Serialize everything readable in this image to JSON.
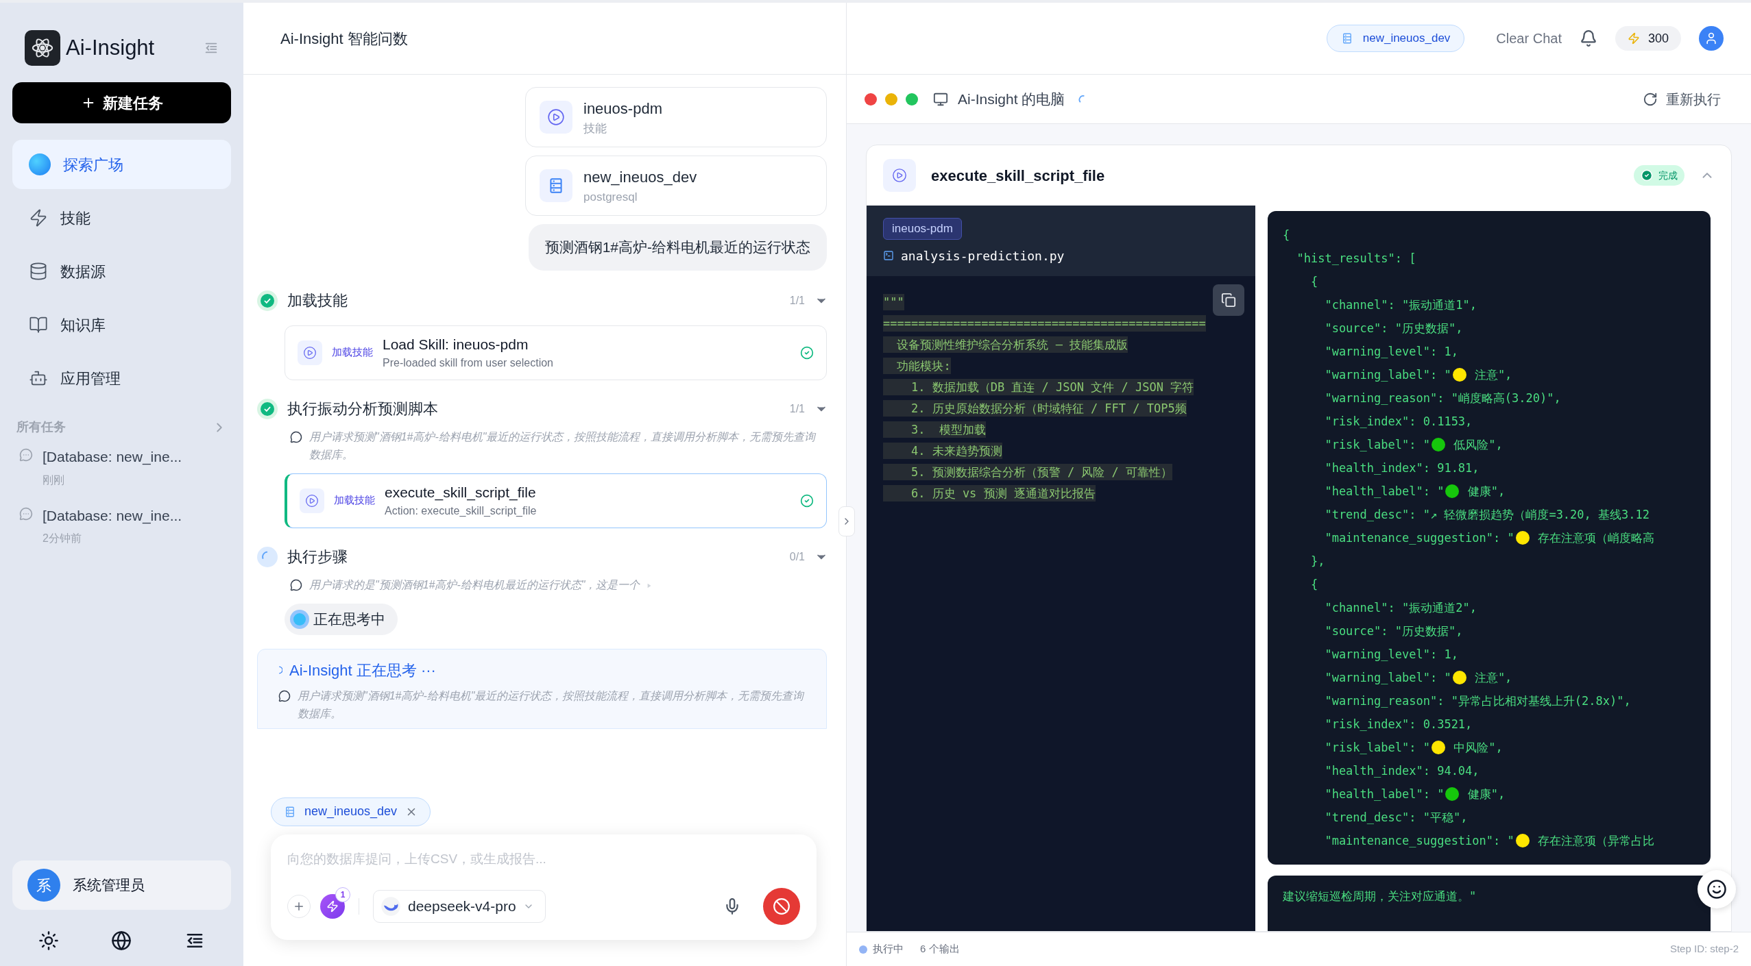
{
  "sidebar": {
    "logo": "Ai-Insight",
    "new_task": "新建任务",
    "nav": [
      {
        "label": "探索广场",
        "selected": true
      },
      {
        "label": "技能",
        "selected": false
      },
      {
        "label": "数据源",
        "selected": false
      },
      {
        "label": "知识库",
        "selected": false
      },
      {
        "label": "应用管理",
        "selected": false
      }
    ],
    "tasks_heading": "所有任务",
    "tasks": [
      {
        "title": "[Database: new_ine...",
        "time": "刚刚"
      },
      {
        "title": "[Database: new_ine...",
        "time": "2分钟前"
      }
    ],
    "user": {
      "avatar": "系",
      "name": "系统管理员"
    }
  },
  "header": {
    "title": "Ai-Insight 智能问数",
    "datasource": "new_ineuos_dev",
    "clear": "Clear Chat",
    "credits": "300"
  },
  "chat": {
    "attachments": [
      {
        "kind": "skill",
        "name": "ineuos-pdm",
        "sub": "技能"
      },
      {
        "kind": "database",
        "name": "new_ineuos_dev",
        "sub": "postgresql"
      }
    ],
    "user_message": "预测酒钢1#高炉-给料电机最近的运行状态",
    "steps": [
      {
        "title": "加载技能",
        "done": true,
        "count": "1/1",
        "items": [
          {
            "tag": "加载技能",
            "title": "Load Skill: ineuos-pdm",
            "subtitle": "Pre-loaded skill from user selection",
            "done": true,
            "selected": false
          }
        ]
      },
      {
        "title": "执行振动分析预测脚本",
        "done": true,
        "count": "1/1",
        "thought": "用户请求预测\"酒钢1#高炉-给料电机\"最近的运行状态，按照技能流程，直接调用分析脚本，无需预先查询数据库。",
        "items": [
          {
            "tag": "加载技能",
            "title": "execute_skill_script_file",
            "subtitle": "Action: execute_skill_script_file",
            "done": true,
            "selected": true
          }
        ]
      },
      {
        "title": "执行步骤",
        "done": false,
        "count": "0/1",
        "thought": "用户请求的是\"预测酒钢1#高炉-给料电机最近的运行状态\"，这是一个",
        "thinking_chip": "正在思考中"
      }
    ],
    "thinking": {
      "title": "Ai-Insight 正在思考 ···",
      "text": "用户请求预测\"酒钢1#高炉-给料电机\"最近的运行状态，按照技能流程，直接调用分析脚本，无需预先查询数据库。"
    }
  },
  "composer": {
    "chip": "new_ineuos_dev",
    "placeholder": "向您的数据库提问，上传CSV，或生成报告...",
    "skills_badge": "1",
    "model": "deepseek-v4-pro"
  },
  "computer": {
    "title": "Ai-Insight 的电脑",
    "rerun": "重新执行",
    "tool": {
      "name": "execute_skill_script_file",
      "status": "完成",
      "skill_tag": "ineuos-pdm",
      "file": "analysis-prediction.py",
      "code_lines": [
        "\"\"\"",
        "==============================================",
        "  设备预测性维护综合分析系统 — 技能集成版",
        "  功能模块:",
        "    1. 数据加载（DB 直连 / JSON 文件 / JSON 字符",
        "    2. 历史原始数据分析（时域特征 / FFT / TOP5频",
        "    3.  模型加载",
        "    4. 未来趋势预测",
        "    5. 预测数据综合分析（预警 / 风险 / 可靠性）",
        "    6. 历史 vs 预测 逐通道对比报告"
      ],
      "output_lines": [
        {
          "text": "{"
        },
        {
          "text": "  \"hist_results\": ["
        },
        {
          "text": "    {"
        },
        {
          "text": "      \"channel\": \"振动通道1\","
        },
        {
          "text": "      \"source\": \"历史数据\","
        },
        {
          "text": "      \"warning_level\": 1,"
        },
        {
          "text": "      \"warning_label\": \"",
          "color": "#ffe600",
          "after": " 注意\","
        },
        {
          "text": "      \"warning_reason\": \"峭度略高(3.20)\","
        },
        {
          "text": "      \"risk_index\": 0.1153,"
        },
        {
          "text": "      \"risk_label\": \"",
          "color": "#16c60c",
          "after": " 低风险\","
        },
        {
          "text": "      \"health_index\": 91.81,"
        },
        {
          "text": "      \"health_label\": \"",
          "color": "#16c60c",
          "after": " 健康\","
        },
        {
          "text": "      \"trend_desc\": \"↗ 轻微磨损趋势（峭度=3.20, 基线3.12"
        },
        {
          "text": "      \"maintenance_suggestion\": \"",
          "color": "#ffe600",
          "after": " 存在注意项（峭度略高"
        },
        {
          "text": "    },"
        },
        {
          "text": "    {"
        },
        {
          "text": "      \"channel\": \"振动通道2\","
        },
        {
          "text": "      \"source\": \"历史数据\","
        },
        {
          "text": "      \"warning_level\": 1,"
        },
        {
          "text": "      \"warning_label\": \"",
          "color": "#ffe600",
          "after": " 注意\","
        },
        {
          "text": "      \"warning_reason\": \"异常占比相对基线上升(2.8x)\","
        },
        {
          "text": "      \"risk_index\": 0.3521,"
        },
        {
          "text": "      \"risk_label\": \"",
          "color": "#ffe600",
          "after": " 中风险\","
        },
        {
          "text": "      \"health_index\": 94.04,"
        },
        {
          "text": "      \"health_label\": \"",
          "color": "#16c60c",
          "after": " 健康\","
        },
        {
          "text": "      \"trend_desc\": \"平稳\","
        },
        {
          "text": "      \"maintenance_suggestion\": \"",
          "color": "#ffe600",
          "after": " 存在注意项（异常占比"
        }
      ],
      "output_more": "建议缩短巡检周期，关注对应通道。\""
    },
    "status": {
      "state": "执行中",
      "outputs": "6 个输出",
      "step": "Step ID: step-2"
    }
  }
}
